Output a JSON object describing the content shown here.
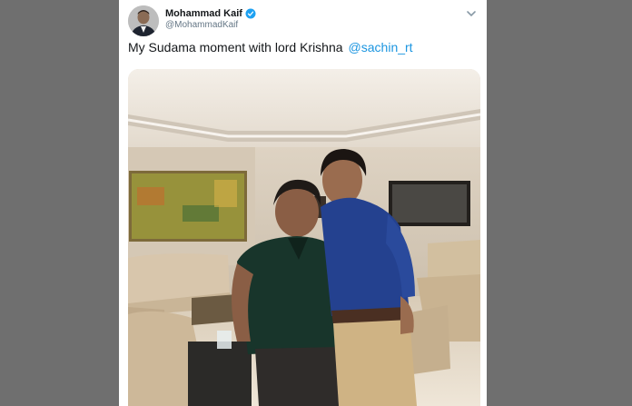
{
  "tweet": {
    "author_name": "Mohammad Kaif",
    "author_handle": "@MohammadKaif",
    "verified_icon": "verified-badge-icon",
    "text": "My Sudama moment with lord Krishna",
    "mention": "@sachin_rt",
    "menu_icon": "chevron-down-icon"
  },
  "colors": {
    "background": "#6f6f6f",
    "card": "#ffffff",
    "text": "#14171a",
    "secondary": "#657786",
    "link": "#1b95e0",
    "verified": "#1da1f2"
  }
}
